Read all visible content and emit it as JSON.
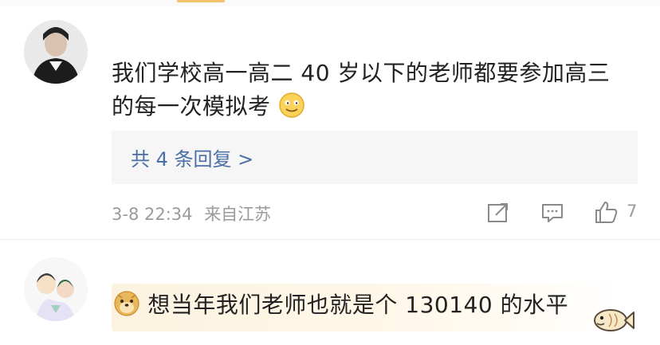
{
  "comments": [
    {
      "text_line1": "我们学校高一高二 40 岁以下的老师都要参加高三",
      "text_line2": "的每一次模拟考",
      "replies_label": "共 4 条回复 >",
      "timestamp": "3-8 22:34",
      "location": "来自江苏",
      "like_count": "7"
    },
    {
      "text": "想当年我们老师也就是个 130140 的水平"
    }
  ],
  "icons": [
    "share-icon",
    "comment-icon",
    "like-icon",
    "emoji-icon",
    "doge-emoji-icon",
    "fish-sticker-icon"
  ],
  "colors": {
    "link": "#4a6fa5",
    "meta": "#9a9a9a",
    "reply_bg": "#f6f6f6"
  }
}
